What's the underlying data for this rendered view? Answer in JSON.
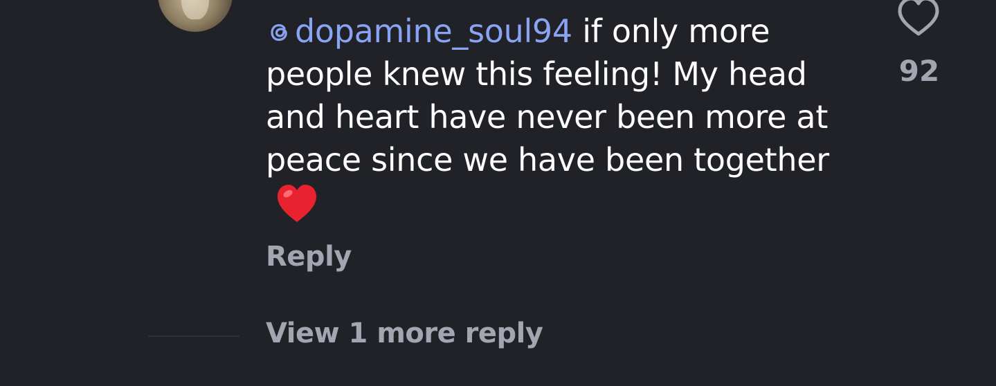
{
  "comment": {
    "mention": "dopamine_soul94",
    "text": "if only more people knew this feeling! My head and heart have never been more at peace since we have been together",
    "emoji": "heart-emoji"
  },
  "actions": {
    "reply_label": "Reply",
    "view_more_label": "View 1 more reply"
  },
  "likes": {
    "count": "92",
    "icon": "heart-outline-icon"
  },
  "colors": {
    "background": "#212128",
    "text": "#ffffff",
    "mention": "#8aa4f5",
    "muted": "#a2a6b0",
    "emoji_red": "#e8222e"
  }
}
